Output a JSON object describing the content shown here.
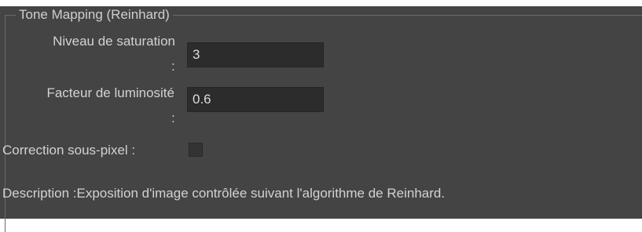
{
  "group": {
    "title": "Tone Mapping (Reinhard)"
  },
  "fields": {
    "saturation": {
      "label": "Niveau de saturation",
      "colon": ":",
      "value": "3"
    },
    "brightness": {
      "label": "Facteur de luminosité",
      "colon": ":",
      "value": "0.6"
    },
    "subpixel": {
      "label": "Correction sous-pixel :",
      "checked": false
    }
  },
  "description": {
    "label": "Description :",
    "text": "Exposition d'image contrôlée suivant l'algorithme de Reinhard."
  },
  "colors": {
    "panel_background": "#444444",
    "input_background": "#2c2c2c",
    "text": "#d2d2d2"
  }
}
